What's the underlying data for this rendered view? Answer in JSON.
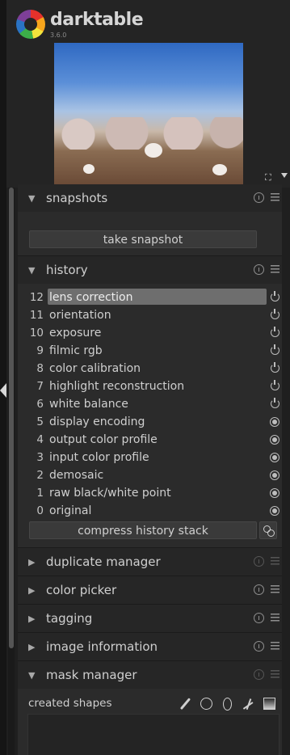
{
  "app": {
    "name": "darktable",
    "version": "3.6.0"
  },
  "snapshots": {
    "title": "snapshots",
    "button": "take snapshot"
  },
  "history": {
    "title": "history",
    "items": [
      {
        "num": "12",
        "label": "lens correction",
        "icon": "power-icon",
        "selected": true
      },
      {
        "num": "11",
        "label": "orientation",
        "icon": "power-icon"
      },
      {
        "num": "10",
        "label": "exposure",
        "icon": "power-icon"
      },
      {
        "num": "9",
        "label": "filmic rgb",
        "icon": "power-icon"
      },
      {
        "num": "8",
        "label": "color calibration",
        "icon": "power-icon"
      },
      {
        "num": "7",
        "label": "highlight reconstruction",
        "icon": "power-icon"
      },
      {
        "num": "6",
        "label": "white balance",
        "icon": "power-icon"
      },
      {
        "num": "5",
        "label": "display encoding",
        "icon": "always-on-icon"
      },
      {
        "num": "4",
        "label": "output color profile",
        "icon": "always-on-icon"
      },
      {
        "num": "3",
        "label": "input color profile",
        "icon": "always-on-icon"
      },
      {
        "num": "2",
        "label": "demosaic",
        "icon": "always-on-icon"
      },
      {
        "num": "1",
        "label": "raw black/white point",
        "icon": "always-on-icon"
      },
      {
        "num": "0",
        "label": "original",
        "icon": "always-on-icon"
      }
    ],
    "compress_button": "compress history stack"
  },
  "modules": {
    "duplicate_manager": "duplicate manager",
    "color_picker": "color picker",
    "tagging": "tagging",
    "image_information": "image information",
    "mask_manager": "mask manager"
  },
  "mask_manager": {
    "created_shapes": "created shapes"
  }
}
